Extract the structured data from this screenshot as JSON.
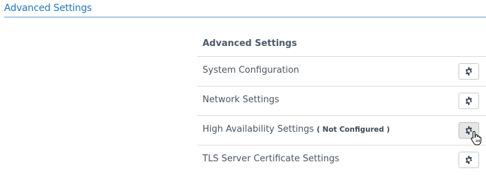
{
  "header": {
    "title": "Advanced Settings"
  },
  "panel": {
    "title": "Advanced Settings",
    "rows": [
      {
        "label": "System Configuration",
        "status": "",
        "button_icon": "gear-icon"
      },
      {
        "label": "Network Settings",
        "status": "",
        "button_icon": "gear-icon"
      },
      {
        "label": "High Availability Settings",
        "status": "( Not Configured )",
        "button_icon": "gear-icon"
      },
      {
        "label": "TLS Server Certificate Settings",
        "status": "",
        "button_icon": "gear-icon"
      }
    ]
  },
  "colors": {
    "accent": "#1e78c2",
    "header_rule": "#a9cde8",
    "text": "#4a5563",
    "icon": "#3d4a5a"
  }
}
